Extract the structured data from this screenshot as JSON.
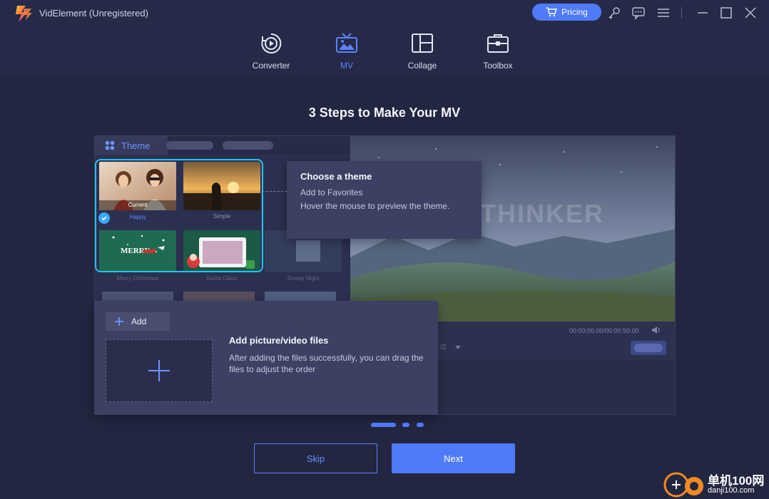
{
  "app": {
    "title": "VidElement (Unregistered)",
    "pricing_label": "Pricing"
  },
  "nav": {
    "items": [
      {
        "label": "Converter",
        "icon": "converter-icon"
      },
      {
        "label": "MV",
        "icon": "mv-icon",
        "active": true
      },
      {
        "label": "Collage",
        "icon": "collage-icon"
      },
      {
        "label": "Toolbox",
        "icon": "toolbox-icon"
      }
    ]
  },
  "main": {
    "heading": "3 Steps to Make Your MV"
  },
  "theme_panel": {
    "tab_label": "Theme",
    "current_label": "Current",
    "themes": [
      {
        "name": "Happy",
        "selected": true
      },
      {
        "name": "Simple"
      },
      {
        "name": "Merry Christmas"
      },
      {
        "name": "Santa Claus"
      },
      {
        "name": "Snowy Night"
      }
    ],
    "merry_text": "MERRY"
  },
  "preview": {
    "watermark": "THINKER",
    "time": "00:00:00.00/00:00:50.00",
    "page_indicator": "/2"
  },
  "callout_theme": {
    "title": "Choose a theme",
    "line1": "Add to Favorites",
    "line2": "Hover the mouse to preview the theme."
  },
  "callout_add": {
    "button_label": "Add",
    "title": "Add picture/video files",
    "description": "After adding the files successfully, you can drag the files to adjust the order"
  },
  "pager": {
    "current": 1,
    "total": 3
  },
  "buttons": {
    "skip": "Skip",
    "next": "Next"
  },
  "site_badge": {
    "line1": "单机100网",
    "line2": "danji100.com"
  },
  "colors": {
    "accent": "#4f7af8",
    "highlight": "#22c4f2",
    "background": "#232640"
  }
}
